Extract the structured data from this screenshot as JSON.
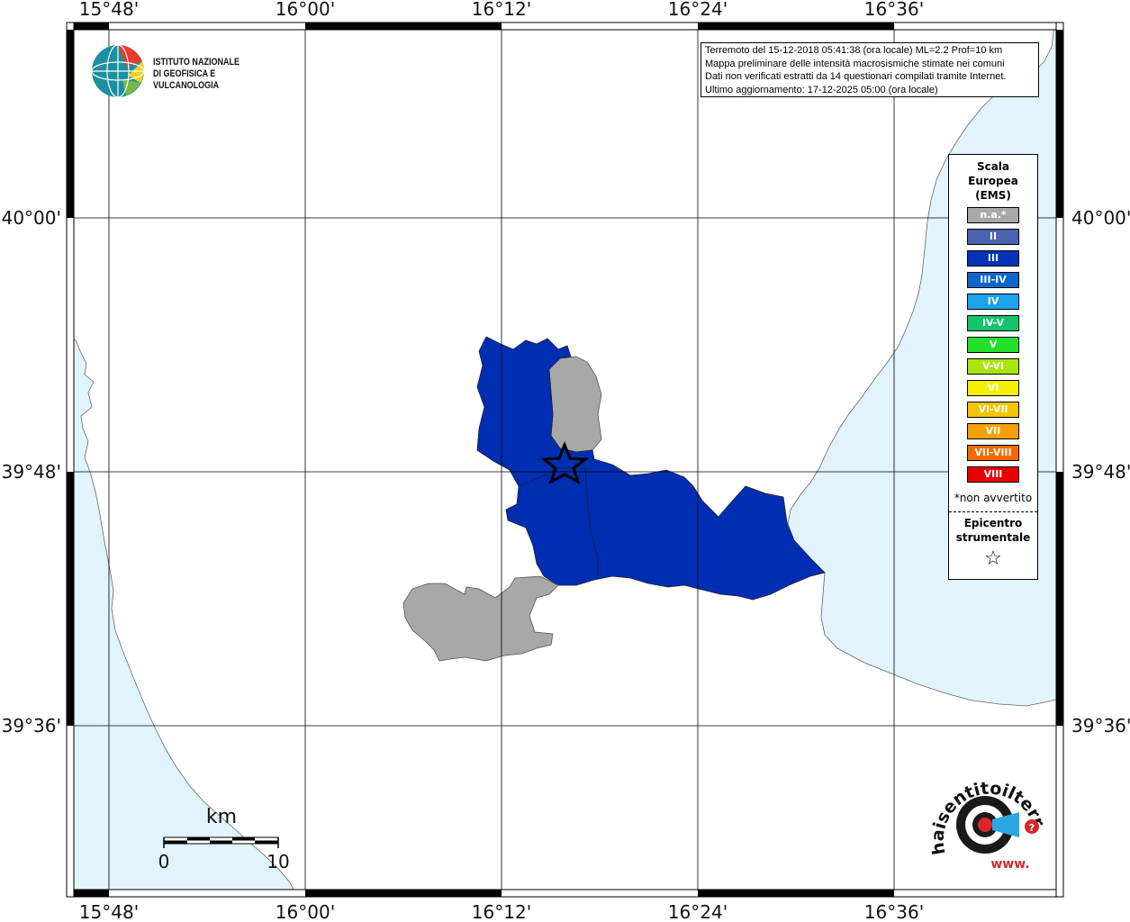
{
  "map": {
    "lon_ticks": [
      "15°48'",
      "16°00'",
      "16°12'",
      "16°24'",
      "16°36'"
    ],
    "lat_ticks": [
      "40°00'",
      "39°48'",
      "39°36'"
    ],
    "colors": {
      "sea": "#e1f3fd",
      "land": "#ffffff",
      "intensity_III": "#002eb3",
      "not_available": "#a8a8a8"
    }
  },
  "title_box": {
    "line1": "Terremoto del 15-12-2018 05:41:38 (ora locale) ML=2.2 Prof=10 km",
    "line2": "Mappa preliminare delle intensità macrosismiche stimate nei comuni",
    "line3": "Dati non verificati estratti da 14 questionari compilati tramite Internet.",
    "line4": "Ultimo aggiornamento: 17-12-2025 05:00 (ora locale)"
  },
  "institute": {
    "line1": "ISTITUTO NAZIONALE",
    "line2": "DI GEOFISICA E VULCANOLOGIA"
  },
  "legend": {
    "title1": "Scala",
    "title2": "Europea",
    "title3": "(EMS)",
    "items": [
      {
        "label": "n.a.*",
        "color": "#a8a8a8"
      },
      {
        "label": "II",
        "color": "#4a62b0"
      },
      {
        "label": "III",
        "color": "#0033b8"
      },
      {
        "label": "III-IV",
        "color": "#0a66cc"
      },
      {
        "label": "IV",
        "color": "#1aa3e8"
      },
      {
        "label": "IV-V",
        "color": "#14c46a"
      },
      {
        "label": "V",
        "color": "#22e02a"
      },
      {
        "label": "V-VI",
        "color": "#a8e60a"
      },
      {
        "label": "VI",
        "color": "#f5f000"
      },
      {
        "label": "VI-VII",
        "color": "#f5c400"
      },
      {
        "label": "VII",
        "color": "#f5a000"
      },
      {
        "label": "VII-VIII",
        "color": "#f56a00"
      },
      {
        "label": "VIII",
        "color": "#e80000"
      }
    ],
    "note": "*non avvertito",
    "epicenter1": "Epicentro",
    "epicenter2": "strumentale",
    "epicenter_icon": "star-outline-icon"
  },
  "scale_bar": {
    "unit": "km",
    "min": "0",
    "max": "10"
  },
  "haisentito": {
    "text": "haisentitoilterremoto.it",
    "prefix": "www."
  }
}
